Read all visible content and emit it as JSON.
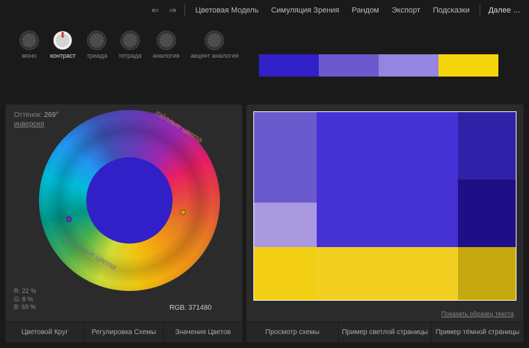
{
  "topbar": {
    "back": "⇐",
    "fwd": "⇒",
    "items": [
      "Цветовая Модель",
      "Симуляция Зрения",
      "Рандом",
      "Экспорт",
      "Подсказки"
    ],
    "more": "Далее …"
  },
  "harmonies": [
    {
      "key": "mono",
      "label": "моно"
    },
    {
      "key": "contrast",
      "label": "контраст"
    },
    {
      "key": "triad",
      "label": "триада"
    },
    {
      "key": "tetrad",
      "label": "тетрада"
    },
    {
      "key": "analog",
      "label": "аналогия"
    },
    {
      "key": "accent",
      "label": "акцент\nаналогия"
    }
  ],
  "activeHarmony": "contrast",
  "palette": [
    "#3120c7",
    "#6a5acd",
    "#9584e0",
    "#f5d60a"
  ],
  "hue": {
    "label": "Оттенок:",
    "value": "269°",
    "inversion": "инверсия"
  },
  "labels": {
    "warm": "тёплые цвета",
    "cold": "холодные цвета"
  },
  "rgb": {
    "r": "R: 22 %",
    "g": "G: 8 %",
    "b": "B: 69 %"
  },
  "hex": {
    "label": "RGB:",
    "value": "371480"
  },
  "leftTabs": [
    "Цветовой Круг",
    "Регулировка Схемы",
    "Значения Цветов"
  ],
  "rightTabs": [
    "Просмотр схемы",
    "Пример светлой страницы",
    "Пример тёмной страницы"
  ],
  "sampleText": "Показать образец текста",
  "previewColors": {
    "a1": "#6a5acd",
    "a2": "#a99ae0",
    "b": "#4631d4",
    "c1": "#3022a8",
    "c2": "#1e0f87",
    "d1": "#f3cf13",
    "d2": "#f1d021",
    "d3": "#c6a80f"
  }
}
